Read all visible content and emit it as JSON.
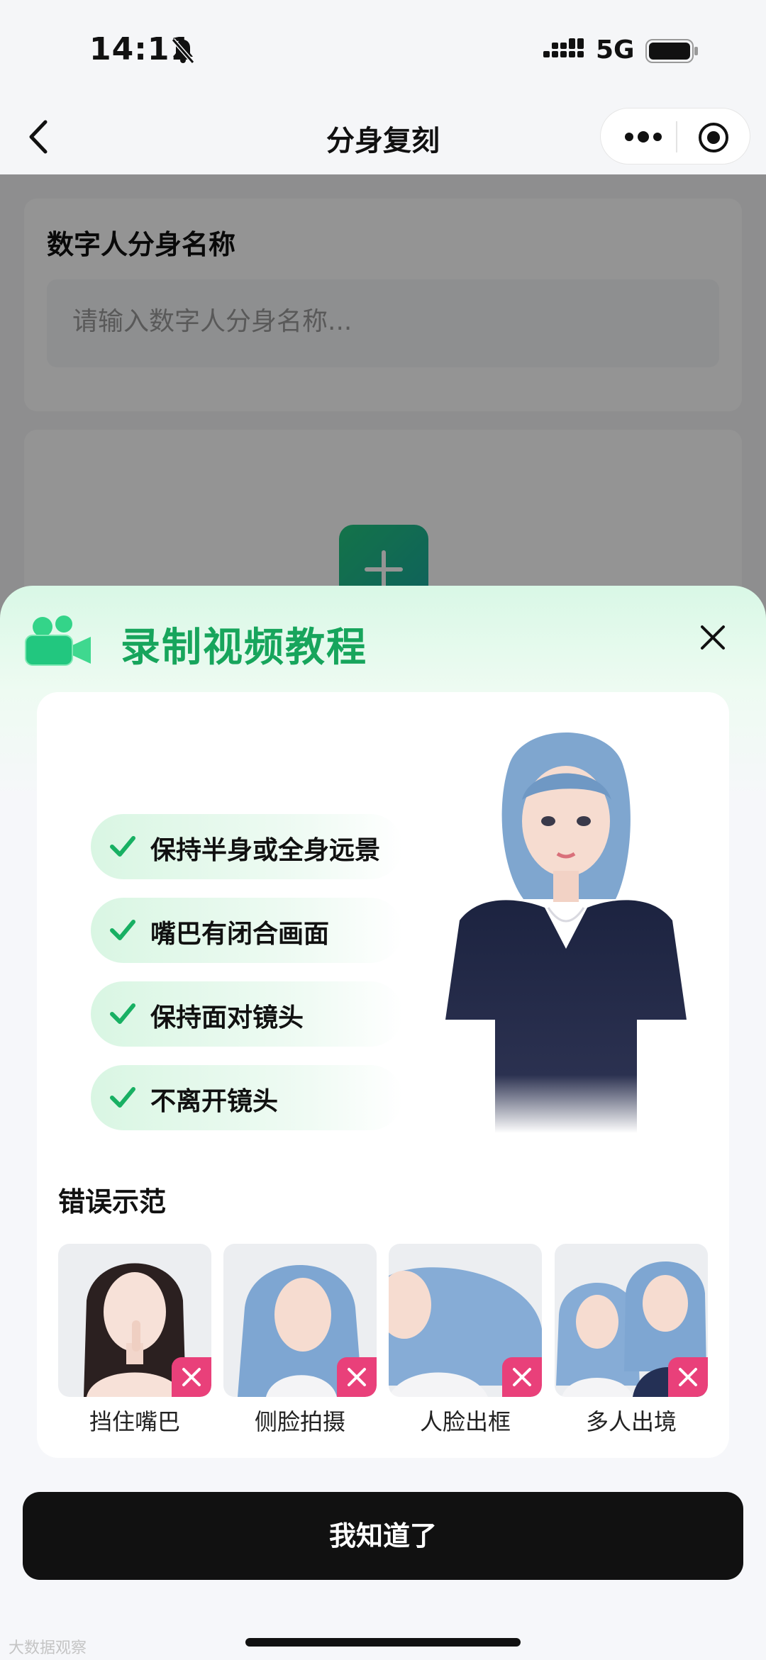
{
  "status_bar": {
    "time": "14:11",
    "network": "5G"
  },
  "nav": {
    "title": "分身复刻"
  },
  "form": {
    "label": "数字人分身名称",
    "input_placeholder": "请输入数字人分身名称..."
  },
  "sheet": {
    "title": "录制视频教程",
    "tips": [
      "保持半身或全身远景",
      "嘴巴有闭合画面",
      "保持面对镜头",
      "不离开镜头"
    ],
    "wrong_title": "错误示范",
    "examples": [
      {
        "label": "挡住嘴巴"
      },
      {
        "label": "侧脸拍摄"
      },
      {
        "label": "人脸出框"
      },
      {
        "label": "多人出境"
      }
    ],
    "confirm_label": "我知道了"
  },
  "watermark": "大数据观察",
  "colors": {
    "accent_green": "#17a55c",
    "error_pink": "#e9407a",
    "button_black": "#111111"
  }
}
